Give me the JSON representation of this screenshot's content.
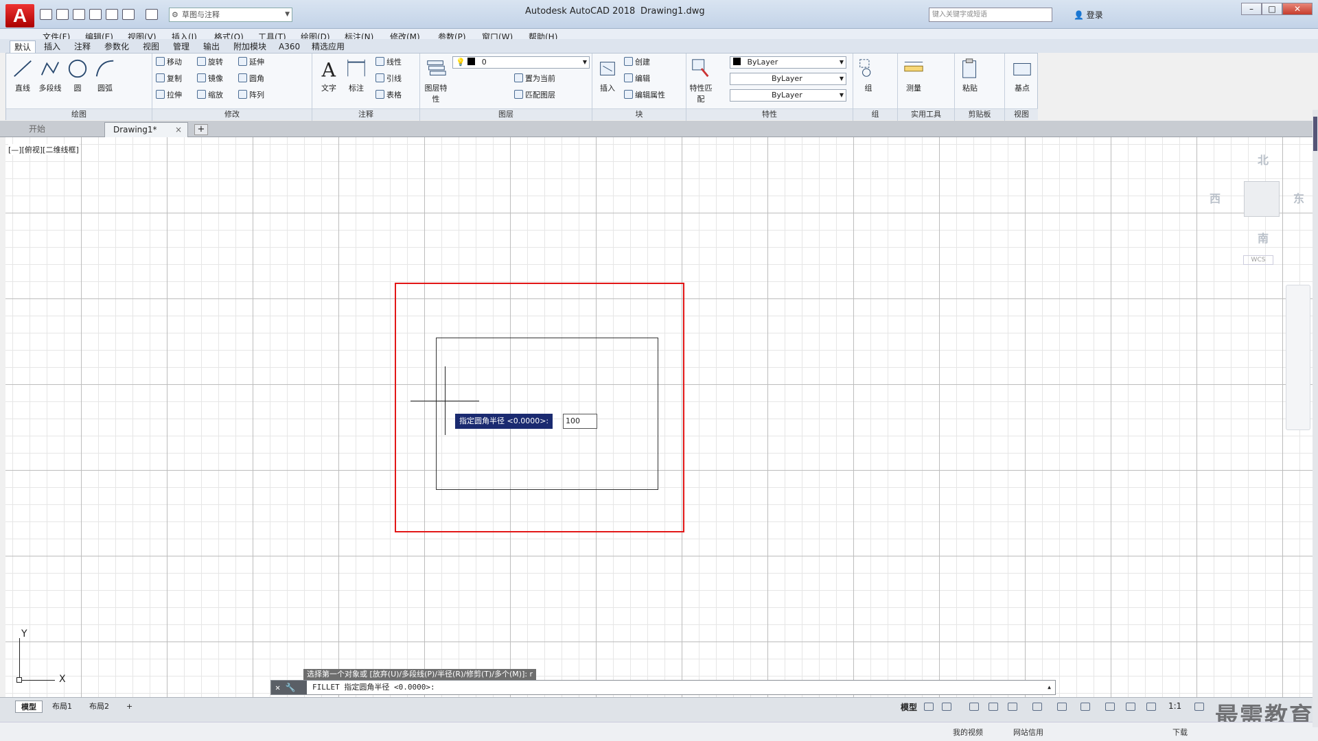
{
  "titlebar": {
    "app_title": "Autodesk AutoCAD 2018",
    "file_title": "Drawing1.dwg",
    "workspace": "草图与注释",
    "search_placeholder": "键入关键字或短语",
    "login": "登录",
    "help": "?",
    "logo": "A"
  },
  "menu": [
    "文件(F)",
    "编辑(E)",
    "视图(V)",
    "插入(I)",
    "格式(O)",
    "工具(T)",
    "绘图(D)",
    "标注(N)",
    "修改(M)",
    "参数(P)",
    "窗口(W)",
    "帮助(H)"
  ],
  "ribbon_tabs": [
    "默认",
    "插入",
    "注释",
    "参数化",
    "视图",
    "管理",
    "输出",
    "附加模块",
    "A360",
    "精选应用"
  ],
  "ribbon": {
    "draw": {
      "title": "绘图",
      "tools": [
        "直线",
        "多段线",
        "圆",
        "圆弧"
      ]
    },
    "modify": {
      "title": "修改",
      "tools": [
        "移动",
        "旋转",
        "延伸",
        "复制",
        "镜像",
        "圆角",
        "拉伸",
        "缩放",
        "阵列"
      ]
    },
    "annotate": {
      "title": "注释",
      "tools": [
        "文字",
        "标注",
        "线性",
        "引线",
        "表格"
      ]
    },
    "layers": {
      "title": "图层",
      "big": "图层特性",
      "layer_name": "0",
      "tools": [
        "置为当前",
        "匹配图层"
      ]
    },
    "block": {
      "title": "块",
      "big": "插入",
      "tools": [
        "创建",
        "编辑",
        "编辑属性"
      ]
    },
    "properties": {
      "title": "特性",
      "big": "特性匹配",
      "color": "ByLayer",
      "linetype": "ByLayer",
      "lineweight": "ByLayer"
    },
    "groups": {
      "title": "组",
      "big": "组"
    },
    "utilities": {
      "title": "实用工具",
      "big": "测量"
    },
    "clipboard": {
      "title": "剪贴板",
      "big": "粘贴"
    },
    "view": {
      "title": "视图",
      "big": "基点"
    }
  },
  "doc_tabs": {
    "start": "开始",
    "drawing": "Drawing1*",
    "close": "×",
    "add": "+"
  },
  "canvas": {
    "viewport_label": "[—][俯视][二维线框]",
    "viewcube": {
      "north": "北",
      "south": "南",
      "east": "东",
      "west": "西",
      "wcs": "WCS"
    },
    "ucs": {
      "x": "X",
      "y": "Y"
    },
    "dynamic_prompt": "指定圆角半径 <0.0000>:",
    "dynamic_input": "100"
  },
  "command": {
    "history": "选择第一个对象或 [放弃(U)/多段线(P)/半径(R)/修剪(T)/多个(M)]: r",
    "current": "FILLET 指定圆角半径 <0.0000>:"
  },
  "layout_tabs": [
    "模型",
    "布局1",
    "布局2",
    "+"
  ],
  "status": {
    "model": "模型",
    "scale": "1:1"
  },
  "taskbar": [
    "我的视频",
    "网站信用",
    "下载"
  ],
  "watermark": "最需教育"
}
